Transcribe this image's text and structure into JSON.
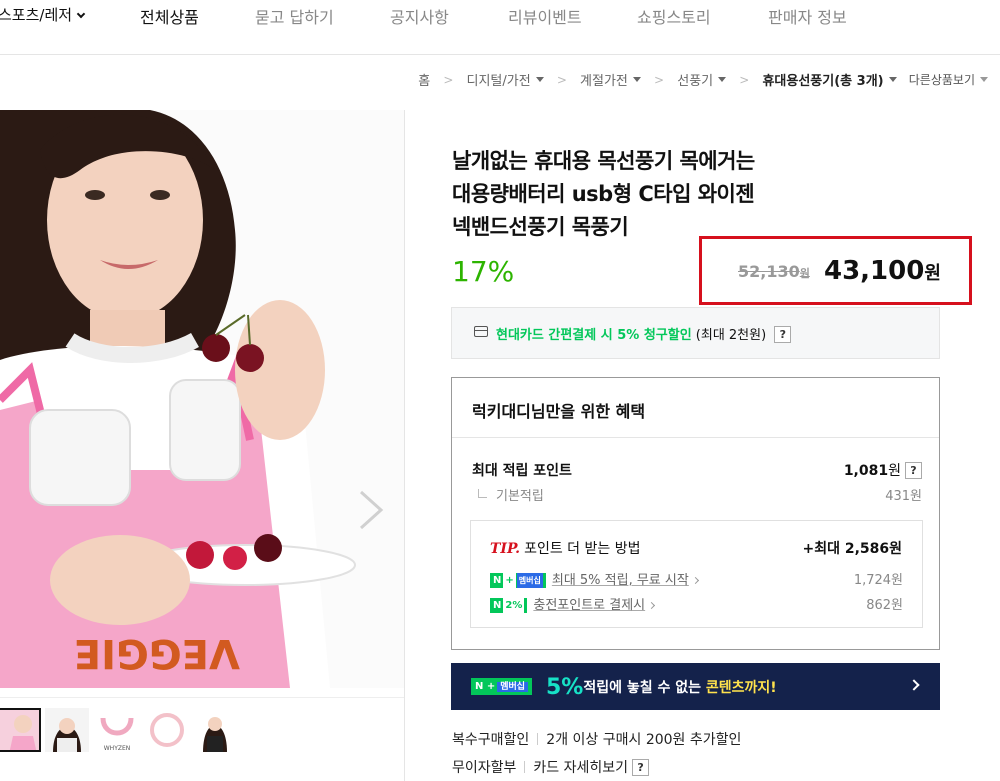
{
  "nav": {
    "category": "스포츠/레저",
    "items": [
      "전체상품",
      "묻고 답하기",
      "공지사항",
      "리뷰이벤트",
      "쇼핑스토리",
      "판매자 정보"
    ]
  },
  "breadcrumb": {
    "items": [
      "홈",
      "디지털/가전",
      "계절가전",
      "선풍기",
      "휴대용선풍기(총 3개)"
    ],
    "other": "다른상품보기"
  },
  "product": {
    "title_lines": [
      "날개없는 휴대용 목선풍기 목에거는",
      "대용량배터리 usb형 C타입 와이젠",
      "넥밴드선풍기 목풍기"
    ],
    "discount": "17%",
    "original_price": "52,130",
    "original_unit": "원",
    "sale_price": "43,100",
    "sale_unit": "원"
  },
  "card_promo": {
    "highlight": "현대카드 간편결제 시 5% 청구할인",
    "rest": " (최대 2천원)",
    "help": "?"
  },
  "benefit": {
    "title": "럭키대디님만을 위한 혜택",
    "max_points_label": "최대 적립 포인트",
    "max_points_value": "1,081",
    "unit": "원",
    "help": "?",
    "basic_label": "기본적립",
    "basic_value": "431원",
    "tip": {
      "word": "TIP.",
      "title": "포인트 더 받는 방법",
      "max": "+최대 2,586원",
      "rows": [
        {
          "badge": "N",
          "badge_extra": "+",
          "badge_mem": "멤버십",
          "label": "최대 5% 적립, 무료 시작",
          "value": "1,724원"
        },
        {
          "badge": "N",
          "badge_extra": "2%",
          "label": "충전포인트로 결제시",
          "value": "862원"
        }
      ]
    }
  },
  "banner": {
    "badge": "N",
    "badge_extra": "+",
    "badge_mem": "멤버십",
    "pct": "5%",
    "text1": "적립에 놓칠 수 없는 ",
    "text2": "콘텐츠까지!"
  },
  "extras": {
    "row1_label": "복수구매할인",
    "row1_value": "2개 이상 구매시 200원 추가할인",
    "row2_label": "무이자할부",
    "row2_value": "카드 자세히보기",
    "help": "?"
  },
  "thumbnails": {
    "brand_label": "WHYZEN"
  },
  "colors": {
    "discount_green": "#2db400",
    "highlight_red": "#d6101d",
    "naver_green": "#03c75a",
    "banner_navy": "#14224b"
  }
}
